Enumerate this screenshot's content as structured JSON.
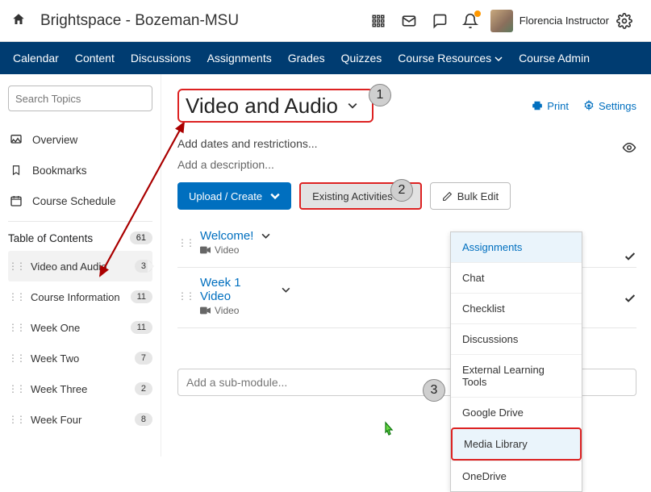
{
  "brand": "Brightspace - Bozeman-MSU",
  "user": "Florencia Instructor",
  "nav": [
    "Calendar",
    "Content",
    "Discussions",
    "Assignments",
    "Grades",
    "Quizzes",
    "Course Resources",
    "Course Admin"
  ],
  "search_placeholder": "Search Topics",
  "sb": {
    "overview": "Overview",
    "bookmarks": "Bookmarks",
    "schedule": "Course Schedule"
  },
  "toc_label": "Table of Contents",
  "toc_count": "61",
  "toc": {
    "i0": {
      "name": "Video and Audio",
      "count": "3"
    },
    "i1": {
      "name": "Course Information",
      "count": "11"
    },
    "i2": {
      "name": "Week One",
      "count": "11"
    },
    "i3": {
      "name": "Week Two",
      "count": "7"
    },
    "i4": {
      "name": "Week Three",
      "count": "2"
    },
    "i5": {
      "name": "Week Four",
      "count": "8"
    }
  },
  "title": "Video and Audio",
  "tools": {
    "print": "Print",
    "settings": "Settings"
  },
  "add_dates": "Add dates and restrictions...",
  "add_desc": "Add a description...",
  "buttons": {
    "upload": "Upload / Create",
    "existing": "Existing Activities",
    "bulk": "Bulk Edit"
  },
  "items": {
    "i0": {
      "name": "Welcome!",
      "type": "Video"
    },
    "i1": {
      "name": "Week 1 Video",
      "type": "Video"
    }
  },
  "dd": {
    "d0": "Assignments",
    "d1": "Chat",
    "d2": "Checklist",
    "d3": "Discussions",
    "d4": "External Learning Tools",
    "d5": "Google Drive",
    "d6": "Media Library",
    "d7": "OneDrive"
  },
  "sub_module": "Add a sub-module...",
  "callouts": {
    "c1": "1",
    "c2": "2",
    "c3": "3"
  }
}
